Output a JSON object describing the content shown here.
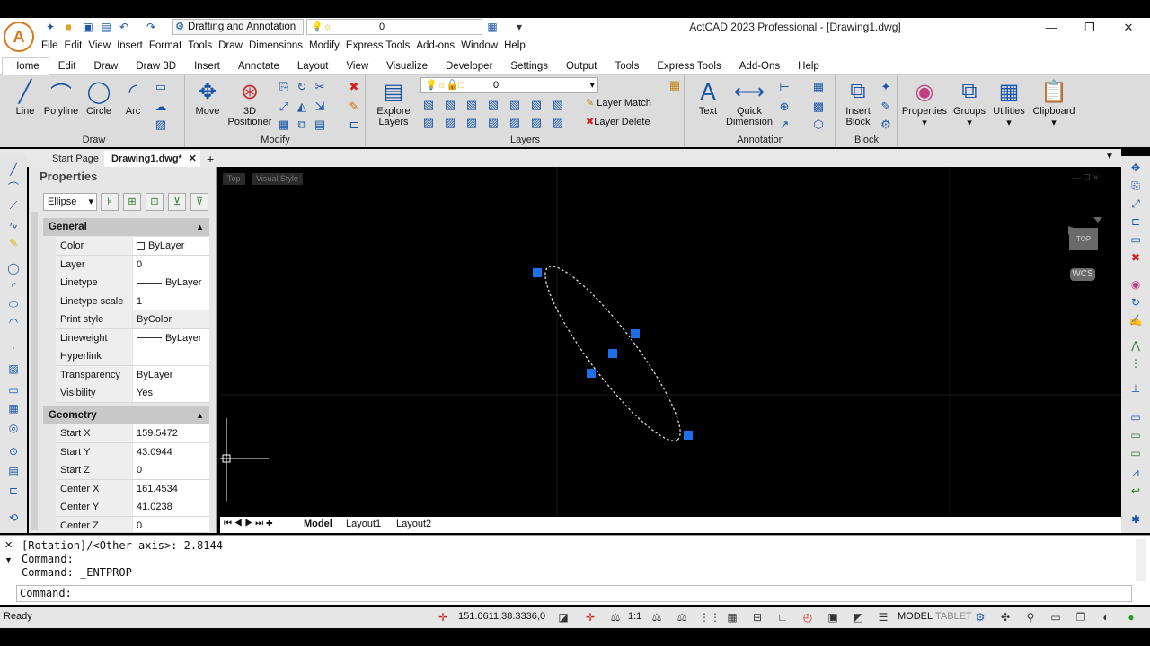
{
  "window": {
    "title": "ActCAD 2023 Professional - [Drawing1.dwg]",
    "minimize": "—",
    "restore": "❐",
    "close": "✕"
  },
  "quick_access": {
    "workspace": "Drafting and Annotation",
    "layer_current": "0"
  },
  "menu": [
    "File",
    "Edit",
    "View",
    "Insert",
    "Format",
    "Tools",
    "Draw",
    "Dimensions",
    "Modify",
    "Express Tools",
    "Add-ons",
    "Window",
    "Help"
  ],
  "ribbon_tabs": [
    "Home",
    "Edit",
    "Draw",
    "Draw 3D",
    "Insert",
    "Annotate",
    "Layout",
    "View",
    "Visualize",
    "Developer",
    "Settings",
    "Output",
    "Tools",
    "Express Tools",
    "Add-Ons",
    "Help"
  ],
  "ribbon": {
    "draw": {
      "title": "Draw",
      "line": "Line",
      "polyline": "Polyline",
      "circle": "Circle",
      "arc": "Arc"
    },
    "modify": {
      "title": "Modify",
      "move": "Move",
      "positioner_1": "3D",
      "positioner_2": "Positioner"
    },
    "layers": {
      "title": "Layers",
      "explore_1": "Explore",
      "explore_2": "Layers",
      "layer_combo": "0",
      "layer_match": "Layer Match",
      "layer_delete": "Layer Delete"
    },
    "annotation": {
      "title": "Annotation",
      "text": "Text",
      "quick_dim_1": "Quick",
      "quick_dim_2": "Dimension"
    },
    "block": {
      "title": "Block",
      "insert_1": "Insert",
      "insert_2": "Block"
    },
    "properties": "Properties",
    "groups": "Groups",
    "utilities": "Utilities",
    "clipboard": "Clipboard"
  },
  "doc_tabs": {
    "start": "Start Page",
    "drawing": "Drawing1.dwg*",
    "add": "+"
  },
  "properties_palette": {
    "title": "Properties",
    "entity": "Ellipse",
    "general_title": "General",
    "general": [
      {
        "k": "Color",
        "v": "ByLayer"
      },
      {
        "k": "Layer",
        "v": "0"
      },
      {
        "k": "Linetype",
        "v": "ByLayer"
      },
      {
        "k": "Linetype scale",
        "v": "1"
      },
      {
        "k": "Print style",
        "v": "ByColor"
      },
      {
        "k": "Lineweight",
        "v": "ByLayer"
      },
      {
        "k": "Hyperlink",
        "v": ""
      },
      {
        "k": "Transparency",
        "v": "ByLayer"
      },
      {
        "k": "Visibility",
        "v": "Yes"
      }
    ],
    "geometry_title": "Geometry",
    "geometry": [
      {
        "k": "Start X",
        "v": "159.5472"
      },
      {
        "k": "Start Y",
        "v": "43.0944"
      },
      {
        "k": "Start Z",
        "v": "0"
      },
      {
        "k": "Center X",
        "v": "161.4534"
      },
      {
        "k": "Center Y",
        "v": "41.0238"
      },
      {
        "k": "Center Z",
        "v": "0"
      }
    ]
  },
  "viewport": {
    "view": "Top",
    "visual_style": "Visual Style",
    "cube_label": "TOP",
    "wcs": "WCS"
  },
  "layout_tabs": {
    "model": "Model",
    "layout1": "Layout1",
    "layout2": "Layout2"
  },
  "command": {
    "history": [
      "[Rotation]/<Other axis>: 2.8144",
      "Command:",
      "Command: _ENTPROP"
    ],
    "prompt": "Command:"
  },
  "status": {
    "ready": "Ready",
    "coords": "151.6611,38.3336,0",
    "scale": "1:1",
    "model": "MODEL",
    "tablet": "TABLET"
  },
  "colors": {
    "accent": "#1a56a8",
    "grip": "#1e6fe8",
    "canvas": "#000000"
  }
}
